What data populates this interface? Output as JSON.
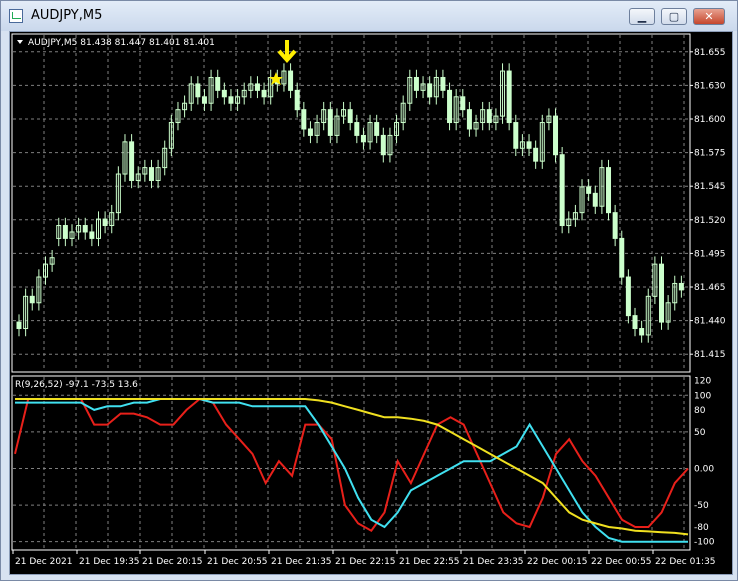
{
  "window": {
    "title": "AUDJPY,M5",
    "buttons": {
      "minimize": "▁",
      "restore": "▢",
      "close": "✕"
    }
  },
  "chart": {
    "header": "AUDJPY,M5  81.438 81.447 81.401 81.401",
    "price_labels": [
      "81.655",
      "81.630",
      "81.600",
      "81.575",
      "81.545",
      "81.520",
      "81.495",
      "81.465",
      "81.440",
      "81.415"
    ],
    "indicator_header": "R(9,26,52) -97.1 -73.5 13.6",
    "indicator_labels": [
      "120",
      "100",
      "80",
      "50",
      "0.00",
      "-50",
      "-80",
      "-100"
    ],
    "time_labels": [
      "21 Dec 2021",
      "21 Dec 19:35",
      "21 Dec 20:15",
      "21 Dec 20:55",
      "21 Dec 21:35",
      "21 Dec 22:15",
      "21 Dec 22:55",
      "21 Dec 23:35",
      "22 Dec 00:15",
      "22 Dec 00:55",
      "22 Dec 01:35"
    ],
    "colors": {
      "background": "#000000",
      "candle": "#ccffcc",
      "grid": "#7f7f7f",
      "line_red": "#e8201a",
      "line_cyan": "#40e0f0",
      "line_yellow": "#f0e020",
      "marker": "#ffee00"
    },
    "markers": {
      "arrow": "arrow-down-icon",
      "star": "star-icon"
    }
  },
  "chart_data": [
    {
      "type": "candlestick",
      "ylim": [
        81.407,
        81.668
      ],
      "closes": [
        81.44,
        81.465,
        81.46,
        81.48,
        81.49,
        81.495,
        81.52,
        81.51,
        81.515,
        81.52,
        81.515,
        81.51,
        81.525,
        81.52,
        81.53,
        81.56,
        81.585,
        81.555,
        81.56,
        81.565,
        81.555,
        81.565,
        81.58,
        81.6,
        81.61,
        81.615,
        81.63,
        81.62,
        81.615,
        81.635,
        81.625,
        81.62,
        81.615,
        81.62,
        81.625,
        81.63,
        81.625,
        81.62,
        81.635,
        81.63,
        81.64,
        81.625,
        81.61,
        81.595,
        81.59,
        81.6,
        81.61,
        81.59,
        81.605,
        81.61,
        81.6,
        81.59,
        81.585,
        81.6,
        81.59,
        81.575,
        81.59,
        81.6,
        81.615,
        81.635,
        81.625,
        81.63,
        81.62,
        81.635,
        81.625,
        81.6,
        81.62,
        81.61,
        81.595,
        81.6,
        81.61,
        81.6,
        81.605,
        81.64,
        81.6,
        81.58,
        81.585,
        81.58,
        81.57,
        81.6,
        81.605,
        81.575,
        81.52,
        81.525,
        81.53,
        81.55,
        81.545,
        81.535,
        81.565,
        81.53,
        81.51,
        81.48,
        81.45,
        81.44,
        81.435,
        81.465,
        81.49,
        81.445,
        81.46,
        81.475,
        81.47
      ],
      "opens": [
        81.445,
        81.44,
        81.465,
        81.46,
        81.48,
        81.49,
        81.51,
        81.52,
        81.51,
        81.515,
        81.52,
        81.515,
        81.51,
        81.525,
        81.52,
        81.53,
        81.56,
        81.585,
        81.555,
        81.56,
        81.565,
        81.555,
        81.565,
        81.58,
        81.6,
        81.61,
        81.615,
        81.63,
        81.62,
        81.615,
        81.635,
        81.625,
        81.62,
        81.615,
        81.62,
        81.625,
        81.63,
        81.625,
        81.62,
        81.635,
        81.63,
        81.64,
        81.625,
        81.61,
        81.595,
        81.59,
        81.6,
        81.61,
        81.59,
        81.605,
        81.61,
        81.6,
        81.59,
        81.585,
        81.6,
        81.59,
        81.575,
        81.59,
        81.6,
        81.615,
        81.635,
        81.625,
        81.63,
        81.62,
        81.635,
        81.625,
        81.6,
        81.62,
        81.61,
        81.595,
        81.6,
        81.61,
        81.6,
        81.605,
        81.64,
        81.6,
        81.58,
        81.585,
        81.58,
        81.57,
        81.6,
        81.605,
        81.575,
        81.52,
        81.525,
        81.53,
        81.55,
        81.545,
        81.535,
        81.565,
        81.53,
        81.51,
        81.48,
        81.45,
        81.44,
        81.435,
        81.465,
        81.49,
        81.445,
        81.46,
        81.475
      ]
    },
    {
      "type": "line",
      "ylim": [
        -110,
        125
      ],
      "series": [
        {
          "color": "#e8201a",
          "values": [
            20,
            95,
            95,
            95,
            95,
            95,
            60,
            60,
            75,
            75,
            70,
            60,
            60,
            80,
            95,
            90,
            60,
            40,
            20,
            -20,
            10,
            -10,
            60,
            60,
            40,
            -50,
            -75,
            -85,
            -60,
            10,
            -20,
            20,
            60,
            70,
            60,
            20,
            -20,
            -60,
            -75,
            -80,
            -40,
            20,
            40,
            10,
            -10,
            -40,
            -70,
            -80,
            -80,
            -60,
            -20,
            0
          ]
        },
        {
          "color": "#40e0f0",
          "values": [
            90,
            90,
            90,
            90,
            90,
            90,
            80,
            85,
            85,
            90,
            90,
            95,
            95,
            95,
            95,
            90,
            90,
            90,
            85,
            85,
            85,
            85,
            85,
            60,
            30,
            0,
            -40,
            -70,
            -80,
            -60,
            -30,
            -20,
            -10,
            0,
            10,
            10,
            10,
            20,
            30,
            60,
            30,
            0,
            -30,
            -60,
            -80,
            -95,
            -100,
            -100,
            -100,
            -100,
            -100,
            -100
          ]
        },
        {
          "color": "#f0e020",
          "values": [
            95,
            95,
            95,
            95,
            95,
            95,
            95,
            95,
            95,
            95,
            95,
            95,
            95,
            95,
            95,
            95,
            95,
            95,
            95,
            95,
            95,
            95,
            95,
            93,
            90,
            85,
            80,
            75,
            70,
            70,
            68,
            65,
            60,
            50,
            40,
            30,
            20,
            10,
            0,
            -10,
            -20,
            -40,
            -60,
            -70,
            -75,
            -80,
            -82,
            -85,
            -86,
            -87,
            -88,
            -90
          ]
        }
      ]
    }
  ]
}
